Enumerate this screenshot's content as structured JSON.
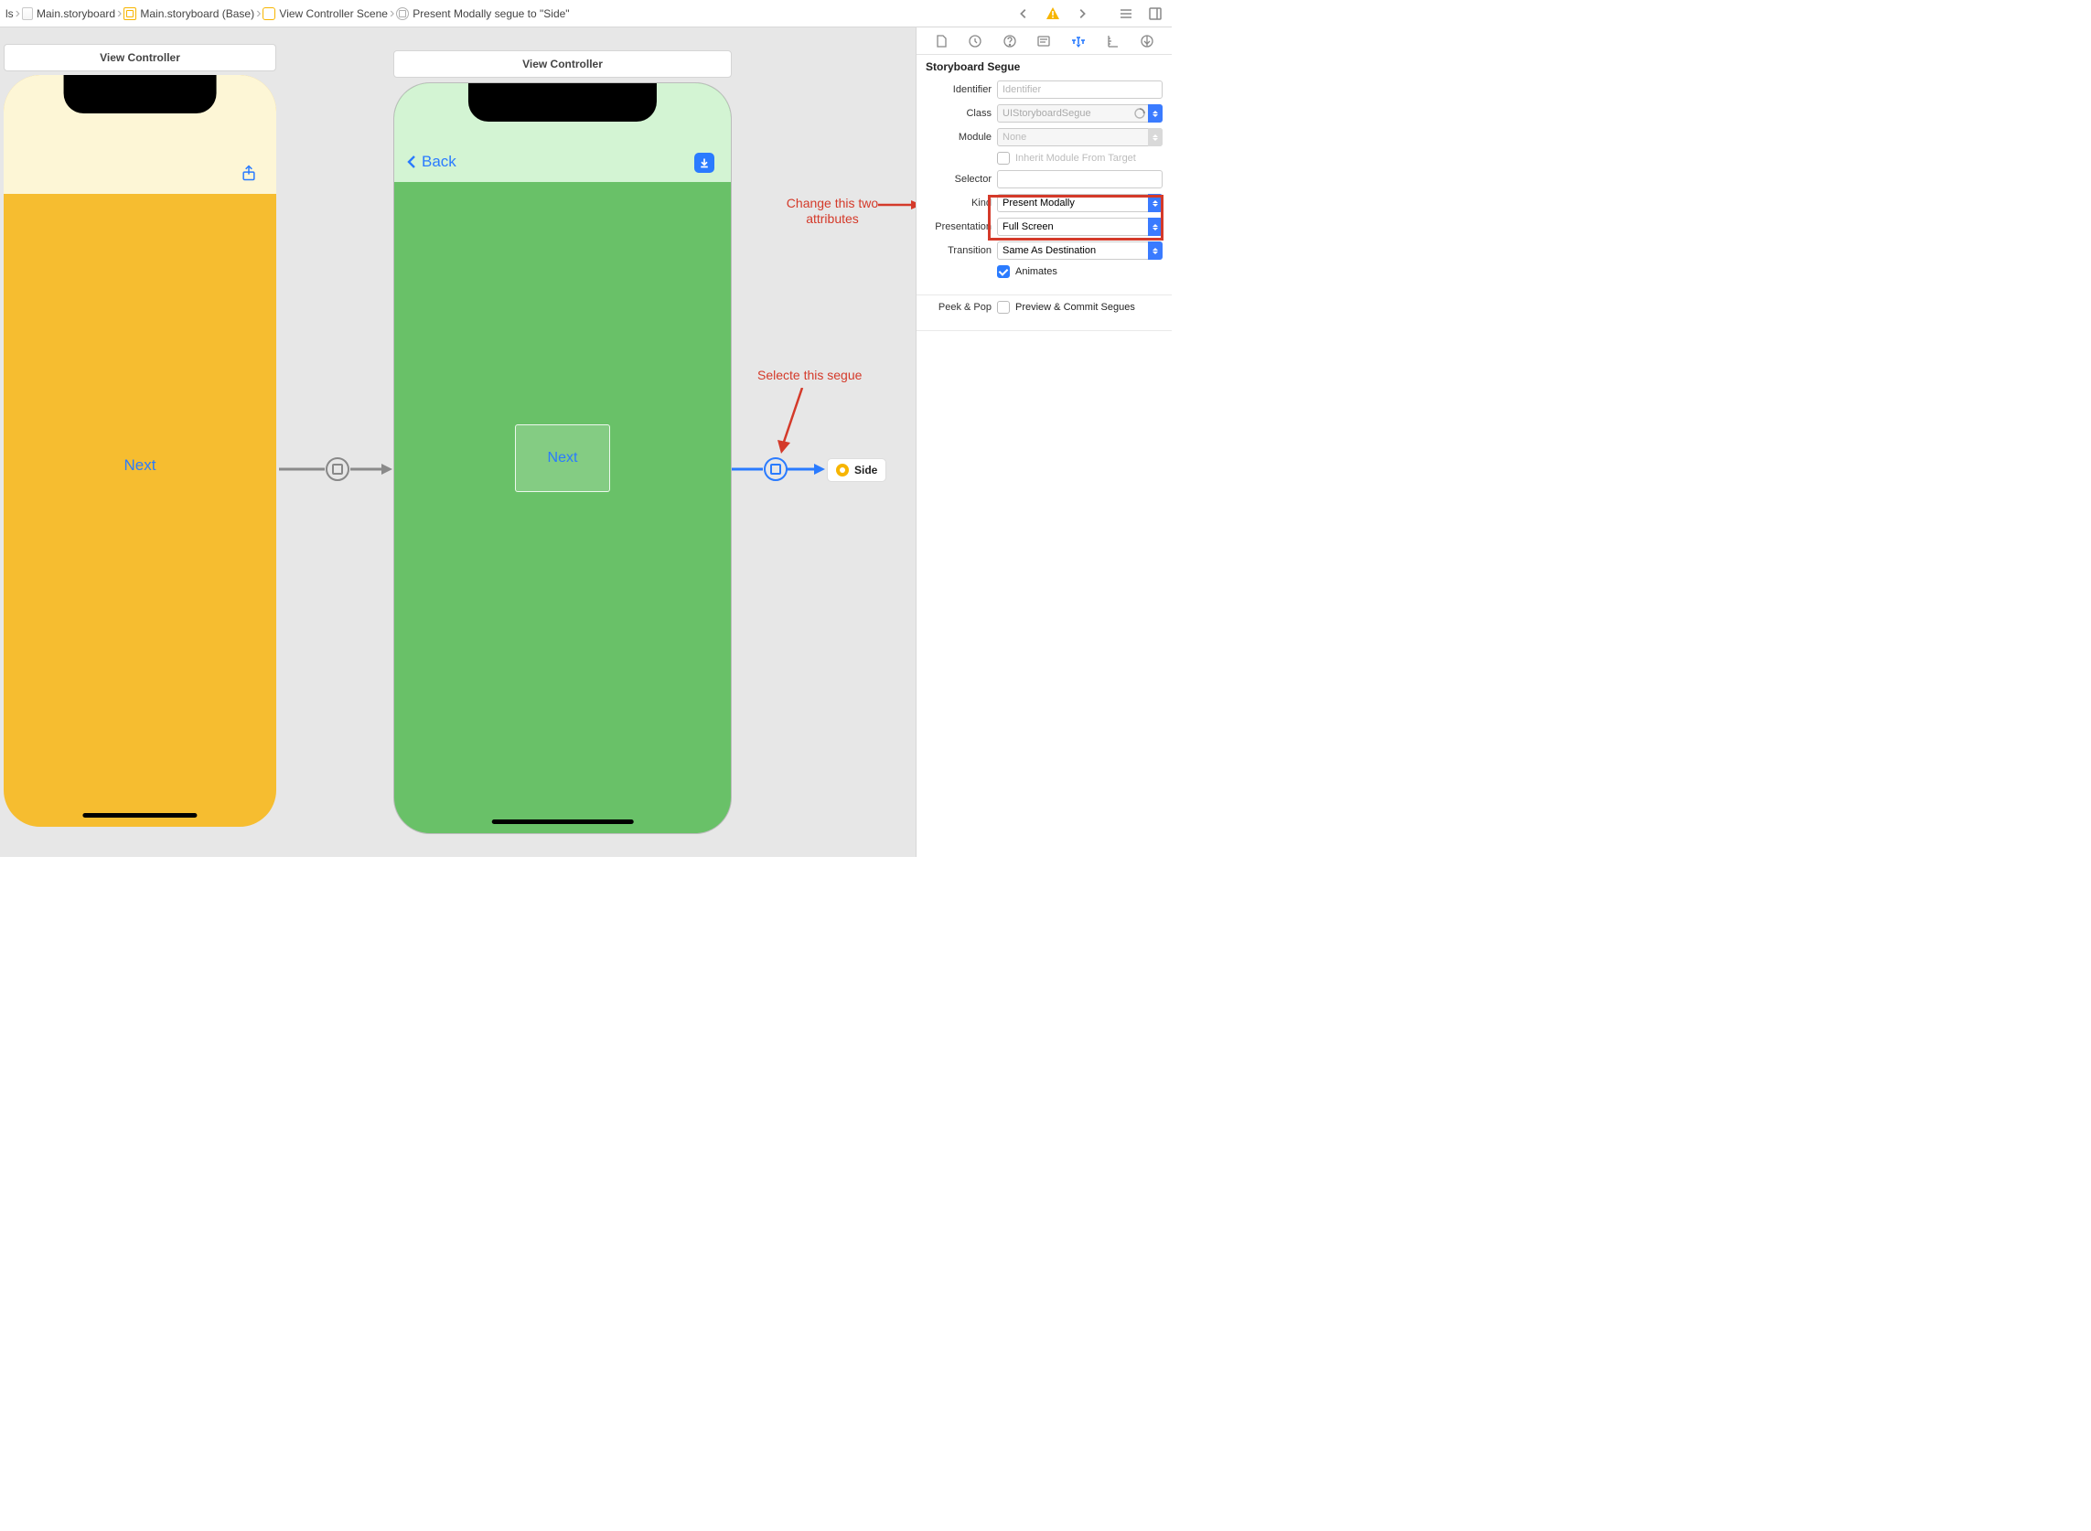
{
  "breadcrumb": {
    "items": [
      {
        "label": "ls"
      },
      {
        "label": "Main.storyboard"
      },
      {
        "label": "Main.storyboard (Base)"
      },
      {
        "label": "View Controller Scene"
      },
      {
        "label": "Present Modally segue to \"Side\""
      }
    ]
  },
  "scenes": {
    "left": {
      "title": "View Controller",
      "button_label": "Next"
    },
    "right": {
      "title": "View Controller",
      "back_label": "Back",
      "container_label": "Next"
    },
    "side_ref": {
      "label": "Side"
    }
  },
  "annotations": {
    "select_segue": "Selecte this segue",
    "change_attrs_line1": "Change this two",
    "change_attrs_line2": "attributes"
  },
  "inspector": {
    "section_title": "Storyboard Segue",
    "labels": {
      "identifier": "Identifier",
      "class": "Class",
      "module": "Module",
      "inherit": "Inherit Module From Target",
      "selector": "Selector",
      "kind": "Kind",
      "presentation": "Presentation",
      "transition": "Transition",
      "animates": "Animates",
      "peek_pop": "Peek & Pop",
      "preview_commit": "Preview & Commit Segues"
    },
    "values": {
      "identifier": "",
      "identifier_placeholder": "Identifier",
      "class": "UIStoryboardSegue",
      "module": "None",
      "selector": "",
      "kind": "Present Modally",
      "presentation": "Full Screen",
      "transition": "Same As Destination",
      "animates_checked": true,
      "inherit_checked": false,
      "preview_commit_checked": false
    }
  }
}
